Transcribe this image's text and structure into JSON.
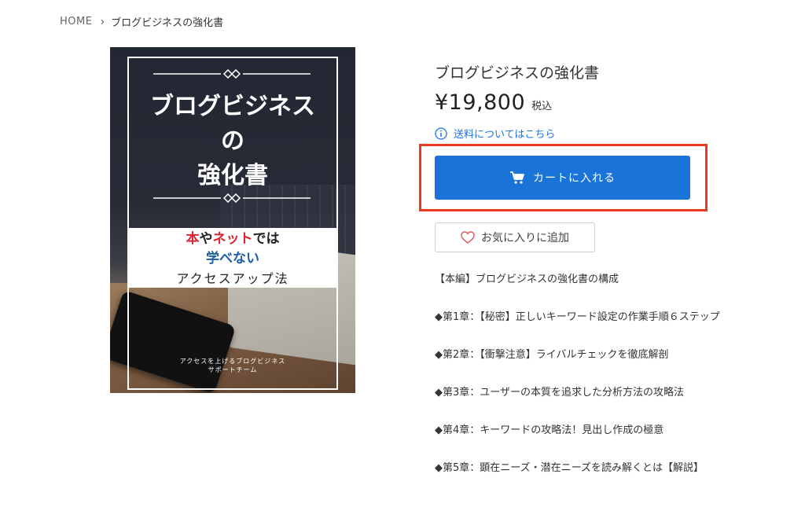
{
  "breadcrumb": {
    "home": "HOME",
    "current": "ブログビジネスの強化書"
  },
  "cover": {
    "title_line1": "ブログビジネス",
    "title_line2": "の",
    "title_line3": "強化書",
    "band_red1": "本",
    "band_text1": "や",
    "band_red2": "ネット",
    "band_text2": "では",
    "band_line2": "学べない",
    "band_line3": "アクセスアップ法",
    "footer_line1": "アクセスを上げるブログビジネス",
    "footer_line2": "サポートチーム"
  },
  "product": {
    "title": "ブログビジネスの強化書",
    "price": "¥19,800",
    "tax_label": "税込",
    "shipping_link": "送料についてはこちら",
    "cart_button": "カートに入れる",
    "favorite_button": "お気に入りに追加"
  },
  "description": [
    "【本編】ブログビジネスの強化書の構成",
    "◆第1章：【秘密】正しいキーワード設定の作業手順６ステップ",
    "◆第2章：【衝撃注意】ライバルチェックを徹底解剖",
    "◆第3章：ユーザーの本質を追求した分析方法の攻略法",
    "◆第4章：キーワードの攻略法！見出し作成の極意",
    "◆第5章：顕在ニーズ・潜在ニーズを読み解くとは【解説】"
  ],
  "colors": {
    "accent_blue": "#1a73d9",
    "highlight_red": "#e93a1f",
    "link_blue": "#1a73e8"
  }
}
